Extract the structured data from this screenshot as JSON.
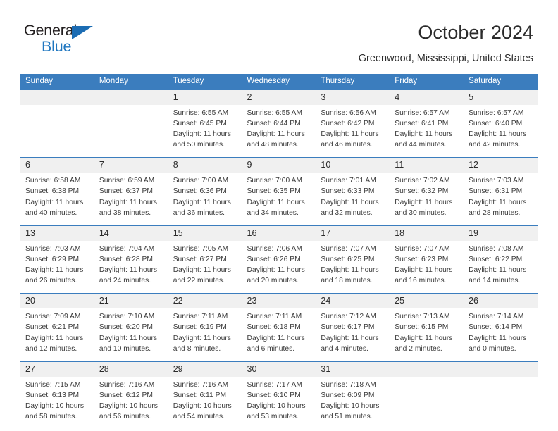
{
  "brand": {
    "name_top": "General",
    "name_bottom": "Blue",
    "accent_color": "#1b6cb3",
    "triangle_icon": "triangle-icon"
  },
  "header": {
    "title": "October 2024",
    "subtitle": "Greenwood, Mississippi, United States"
  },
  "colors": {
    "header_band": "#3b7dbe",
    "daynum_band": "#f0f0f0",
    "week_rule": "#3b7dbe",
    "text": "#3a3a3a"
  },
  "calendar": {
    "weekday_headers": [
      "Sunday",
      "Monday",
      "Tuesday",
      "Wednesday",
      "Thursday",
      "Friday",
      "Saturday"
    ],
    "weeks": [
      {
        "days": [
          {
            "num": "",
            "sunrise": "",
            "sunset": "",
            "daylight": ""
          },
          {
            "num": "",
            "sunrise": "",
            "sunset": "",
            "daylight": ""
          },
          {
            "num": "1",
            "sunrise": "Sunrise: 6:55 AM",
            "sunset": "Sunset: 6:45 PM",
            "daylight": "Daylight: 11 hours and 50 minutes."
          },
          {
            "num": "2",
            "sunrise": "Sunrise: 6:55 AM",
            "sunset": "Sunset: 6:44 PM",
            "daylight": "Daylight: 11 hours and 48 minutes."
          },
          {
            "num": "3",
            "sunrise": "Sunrise: 6:56 AM",
            "sunset": "Sunset: 6:42 PM",
            "daylight": "Daylight: 11 hours and 46 minutes."
          },
          {
            "num": "4",
            "sunrise": "Sunrise: 6:57 AM",
            "sunset": "Sunset: 6:41 PM",
            "daylight": "Daylight: 11 hours and 44 minutes."
          },
          {
            "num": "5",
            "sunrise": "Sunrise: 6:57 AM",
            "sunset": "Sunset: 6:40 PM",
            "daylight": "Daylight: 11 hours and 42 minutes."
          }
        ]
      },
      {
        "days": [
          {
            "num": "6",
            "sunrise": "Sunrise: 6:58 AM",
            "sunset": "Sunset: 6:38 PM",
            "daylight": "Daylight: 11 hours and 40 minutes."
          },
          {
            "num": "7",
            "sunrise": "Sunrise: 6:59 AM",
            "sunset": "Sunset: 6:37 PM",
            "daylight": "Daylight: 11 hours and 38 minutes."
          },
          {
            "num": "8",
            "sunrise": "Sunrise: 7:00 AM",
            "sunset": "Sunset: 6:36 PM",
            "daylight": "Daylight: 11 hours and 36 minutes."
          },
          {
            "num": "9",
            "sunrise": "Sunrise: 7:00 AM",
            "sunset": "Sunset: 6:35 PM",
            "daylight": "Daylight: 11 hours and 34 minutes."
          },
          {
            "num": "10",
            "sunrise": "Sunrise: 7:01 AM",
            "sunset": "Sunset: 6:33 PM",
            "daylight": "Daylight: 11 hours and 32 minutes."
          },
          {
            "num": "11",
            "sunrise": "Sunrise: 7:02 AM",
            "sunset": "Sunset: 6:32 PM",
            "daylight": "Daylight: 11 hours and 30 minutes."
          },
          {
            "num": "12",
            "sunrise": "Sunrise: 7:03 AM",
            "sunset": "Sunset: 6:31 PM",
            "daylight": "Daylight: 11 hours and 28 minutes."
          }
        ]
      },
      {
        "days": [
          {
            "num": "13",
            "sunrise": "Sunrise: 7:03 AM",
            "sunset": "Sunset: 6:29 PM",
            "daylight": "Daylight: 11 hours and 26 minutes."
          },
          {
            "num": "14",
            "sunrise": "Sunrise: 7:04 AM",
            "sunset": "Sunset: 6:28 PM",
            "daylight": "Daylight: 11 hours and 24 minutes."
          },
          {
            "num": "15",
            "sunrise": "Sunrise: 7:05 AM",
            "sunset": "Sunset: 6:27 PM",
            "daylight": "Daylight: 11 hours and 22 minutes."
          },
          {
            "num": "16",
            "sunrise": "Sunrise: 7:06 AM",
            "sunset": "Sunset: 6:26 PM",
            "daylight": "Daylight: 11 hours and 20 minutes."
          },
          {
            "num": "17",
            "sunrise": "Sunrise: 7:07 AM",
            "sunset": "Sunset: 6:25 PM",
            "daylight": "Daylight: 11 hours and 18 minutes."
          },
          {
            "num": "18",
            "sunrise": "Sunrise: 7:07 AM",
            "sunset": "Sunset: 6:23 PM",
            "daylight": "Daylight: 11 hours and 16 minutes."
          },
          {
            "num": "19",
            "sunrise": "Sunrise: 7:08 AM",
            "sunset": "Sunset: 6:22 PM",
            "daylight": "Daylight: 11 hours and 14 minutes."
          }
        ]
      },
      {
        "days": [
          {
            "num": "20",
            "sunrise": "Sunrise: 7:09 AM",
            "sunset": "Sunset: 6:21 PM",
            "daylight": "Daylight: 11 hours and 12 minutes."
          },
          {
            "num": "21",
            "sunrise": "Sunrise: 7:10 AM",
            "sunset": "Sunset: 6:20 PM",
            "daylight": "Daylight: 11 hours and 10 minutes."
          },
          {
            "num": "22",
            "sunrise": "Sunrise: 7:11 AM",
            "sunset": "Sunset: 6:19 PM",
            "daylight": "Daylight: 11 hours and 8 minutes."
          },
          {
            "num": "23",
            "sunrise": "Sunrise: 7:11 AM",
            "sunset": "Sunset: 6:18 PM",
            "daylight": "Daylight: 11 hours and 6 minutes."
          },
          {
            "num": "24",
            "sunrise": "Sunrise: 7:12 AM",
            "sunset": "Sunset: 6:17 PM",
            "daylight": "Daylight: 11 hours and 4 minutes."
          },
          {
            "num": "25",
            "sunrise": "Sunrise: 7:13 AM",
            "sunset": "Sunset: 6:15 PM",
            "daylight": "Daylight: 11 hours and 2 minutes."
          },
          {
            "num": "26",
            "sunrise": "Sunrise: 7:14 AM",
            "sunset": "Sunset: 6:14 PM",
            "daylight": "Daylight: 11 hours and 0 minutes."
          }
        ]
      },
      {
        "days": [
          {
            "num": "27",
            "sunrise": "Sunrise: 7:15 AM",
            "sunset": "Sunset: 6:13 PM",
            "daylight": "Daylight: 10 hours and 58 minutes."
          },
          {
            "num": "28",
            "sunrise": "Sunrise: 7:16 AM",
            "sunset": "Sunset: 6:12 PM",
            "daylight": "Daylight: 10 hours and 56 minutes."
          },
          {
            "num": "29",
            "sunrise": "Sunrise: 7:16 AM",
            "sunset": "Sunset: 6:11 PM",
            "daylight": "Daylight: 10 hours and 54 minutes."
          },
          {
            "num": "30",
            "sunrise": "Sunrise: 7:17 AM",
            "sunset": "Sunset: 6:10 PM",
            "daylight": "Daylight: 10 hours and 53 minutes."
          },
          {
            "num": "31",
            "sunrise": "Sunrise: 7:18 AM",
            "sunset": "Sunset: 6:09 PM",
            "daylight": "Daylight: 10 hours and 51 minutes."
          },
          {
            "num": "",
            "sunrise": "",
            "sunset": "",
            "daylight": ""
          },
          {
            "num": "",
            "sunrise": "",
            "sunset": "",
            "daylight": ""
          }
        ]
      }
    ]
  }
}
